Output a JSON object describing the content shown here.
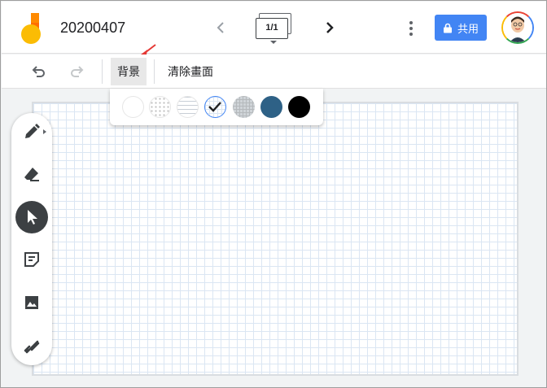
{
  "app": {
    "title": "20200407"
  },
  "nav": {
    "frame_indicator": "1/1"
  },
  "share": {
    "label": "共用"
  },
  "toolbar": {
    "background_label": "背景",
    "clear_label": "清除畫面"
  },
  "background_options": [
    "blank",
    "dot-grid",
    "lined",
    "square-grid",
    "graph",
    "blue",
    "black"
  ],
  "background_selected": "square-grid",
  "colors": {
    "accent": "#4285f4",
    "swatch_blue": "#2e6186",
    "swatch_black": "#000000",
    "annotation_arrow": "#e53935"
  },
  "tools": [
    "pen-icon",
    "eraser-icon",
    "select-icon",
    "sticky-note-icon",
    "image-icon",
    "laser-icon"
  ],
  "active_tool": "select-icon"
}
